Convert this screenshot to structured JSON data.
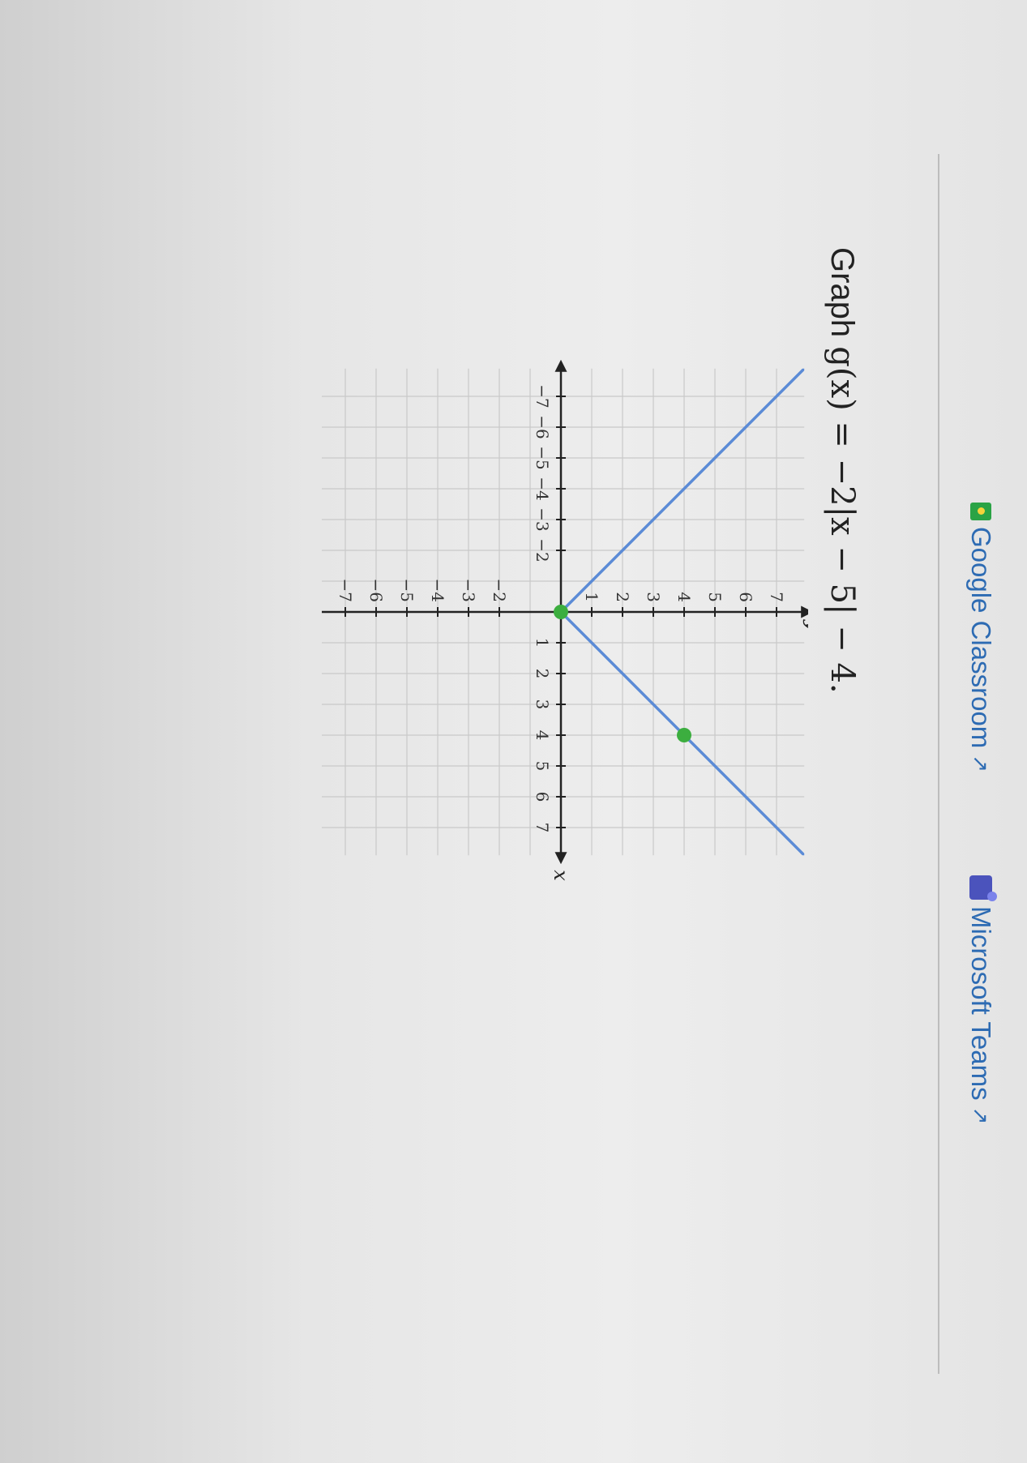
{
  "links": {
    "google_classroom": "Google Classroom",
    "microsoft_teams": "Microsoft Teams",
    "google_classroom_icon": "google-classroom-icon",
    "microsoft_teams_icon": "microsoft-teams-icon",
    "external_link_icon": "external-link-icon"
  },
  "question": {
    "lead": "Graph",
    "expression": "g(x) = −2|x − 5| − 4."
  },
  "colors": {
    "line": "#5b8bd6",
    "point": "#3cae3f",
    "grid": "#c9c9c9",
    "axis": "#222222",
    "link": "#2d6bb3"
  },
  "chart_data": {
    "type": "line",
    "xlabel": "x",
    "ylabel": "y",
    "xlim": [
      -7,
      7
    ],
    "ylim": [
      -7,
      7
    ],
    "grid": true,
    "x_ticks": [
      {
        "value": -7,
        "label": "−7"
      },
      {
        "value": -6,
        "label": "−6"
      },
      {
        "value": -5,
        "label": "−5"
      },
      {
        "value": -4,
        "label": "−4"
      },
      {
        "value": -3,
        "label": "−3"
      },
      {
        "value": -2,
        "label": "−2"
      },
      {
        "value": 1,
        "label": "1"
      },
      {
        "value": 2,
        "label": "2"
      },
      {
        "value": 3,
        "label": "3"
      },
      {
        "value": 4,
        "label": "4"
      },
      {
        "value": 5,
        "label": "5"
      },
      {
        "value": 6,
        "label": "6"
      },
      {
        "value": 7,
        "label": "7"
      }
    ],
    "y_ticks": [
      {
        "value": 7,
        "label": "7"
      },
      {
        "value": 6,
        "label": "6"
      },
      {
        "value": 5,
        "label": "5"
      },
      {
        "value": 4,
        "label": "4"
      },
      {
        "value": 3,
        "label": "3"
      },
      {
        "value": 2,
        "label": "2"
      },
      {
        "value": 1,
        "label": "1"
      },
      {
        "value": -2,
        "label": "−2"
      },
      {
        "value": -3,
        "label": "−3"
      },
      {
        "value": -4,
        "label": "−4"
      },
      {
        "value": -5,
        "label": "−5"
      },
      {
        "value": -6,
        "label": "−6"
      },
      {
        "value": -7,
        "label": "−7"
      }
    ],
    "series": [
      {
        "x": [
          -8,
          0,
          8
        ],
        "y": [
          8,
          0,
          8
        ]
      }
    ],
    "points": [
      {
        "x": 0,
        "y": 0
      },
      {
        "x": 4,
        "y": 4
      }
    ]
  }
}
